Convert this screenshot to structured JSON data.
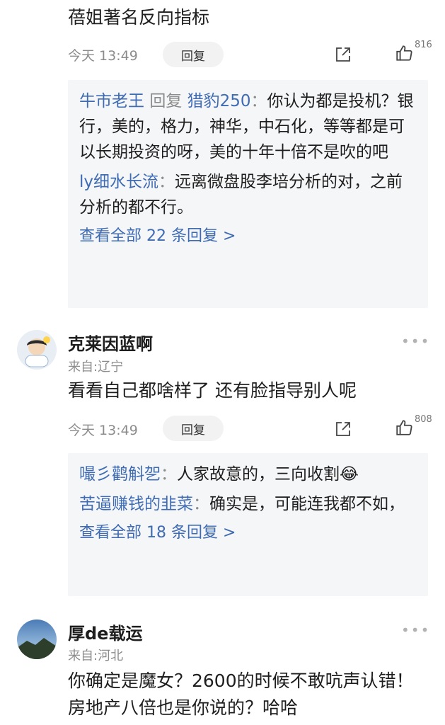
{
  "comments": [
    {
      "text": "蓓姐著名反向指标",
      "time": "今天 13:49",
      "reply_label": "回复",
      "likes": "816",
      "replies": [
        {
          "nick": "牛市老王",
          "reply_word": "回复",
          "target": "猎豹250",
          "sep": "：",
          "text": "你认为都是投机？银行，美的，格力，神华，中石化，等等都是可以长期投资的呀，美的十年十倍不是吹的吧"
        },
        {
          "nick": "ly细水长流",
          "sep": "：",
          "text": "远离微盘股李培分析的对，之前分析的都不行。"
        }
      ],
      "view_all": "查看全部 22 条回复 >"
    },
    {
      "username": "克莱因蓝啊",
      "location": "来自:辽宁",
      "text": "看看自己都啥样了  还有脸指导别人呢",
      "time": "今天 13:49",
      "reply_label": "回复",
      "likes": "808",
      "replies": [
        {
          "nick": "嘬彡鹳斛乫",
          "sep": "：",
          "text": "人家故意的，三向收割😂"
        },
        {
          "nick": "苦逼赚钱的韭菜",
          "sep": "：",
          "text": "确实是，可能连我都不如，"
        }
      ],
      "view_all": "查看全部 18 条回复 >"
    },
    {
      "username": "厚de载运",
      "location": "来自:河北",
      "text": "你确定是魔女？2600的时候不敢吭声认错！房地产八倍也是你说的？哈哈"
    }
  ],
  "icons": {
    "share": "share-icon",
    "like": "thumbs-up-icon",
    "more": "more-dots-icon"
  },
  "colors": {
    "link": "#3f6bb3",
    "reply_bg": "#f5f6f8",
    "meta": "#8c8c8c"
  }
}
